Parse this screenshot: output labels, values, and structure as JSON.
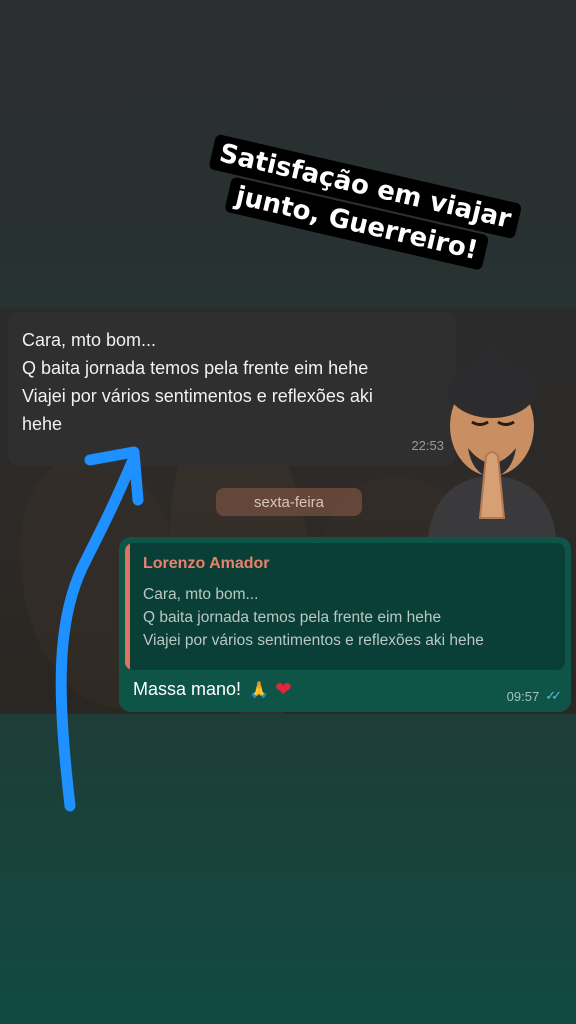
{
  "sticker": {
    "text": "Satisfação em viajar junto, Guerreiro!"
  },
  "incoming_message": {
    "lines": [
      "Cara, mto bom...",
      "Q baita jornada temos pela frente eim hehe",
      "",
      "Viajei por vários sentimentos e reflexões aki",
      "hehe"
    ],
    "time": "22:53"
  },
  "date_separator": "sexta-feira",
  "outgoing_message": {
    "quoted_author": "Lorenzo Amador",
    "quoted_lines": [
      "Cara, mto bom...",
      "Q baita jornada temos pela frente eim hehe",
      "Viajei por vários sentimentos e reflexões aki hehe"
    ],
    "text": "Massa mano!",
    "emojis": [
      "folded-hands",
      "red-heart"
    ],
    "time": "09:57",
    "status": "read"
  },
  "colors": {
    "arrow": "#1e90ff",
    "quote_bar": "#e0735c",
    "read_ticks": "#53bdeb",
    "outgoing_bubble": "#0e5548"
  }
}
